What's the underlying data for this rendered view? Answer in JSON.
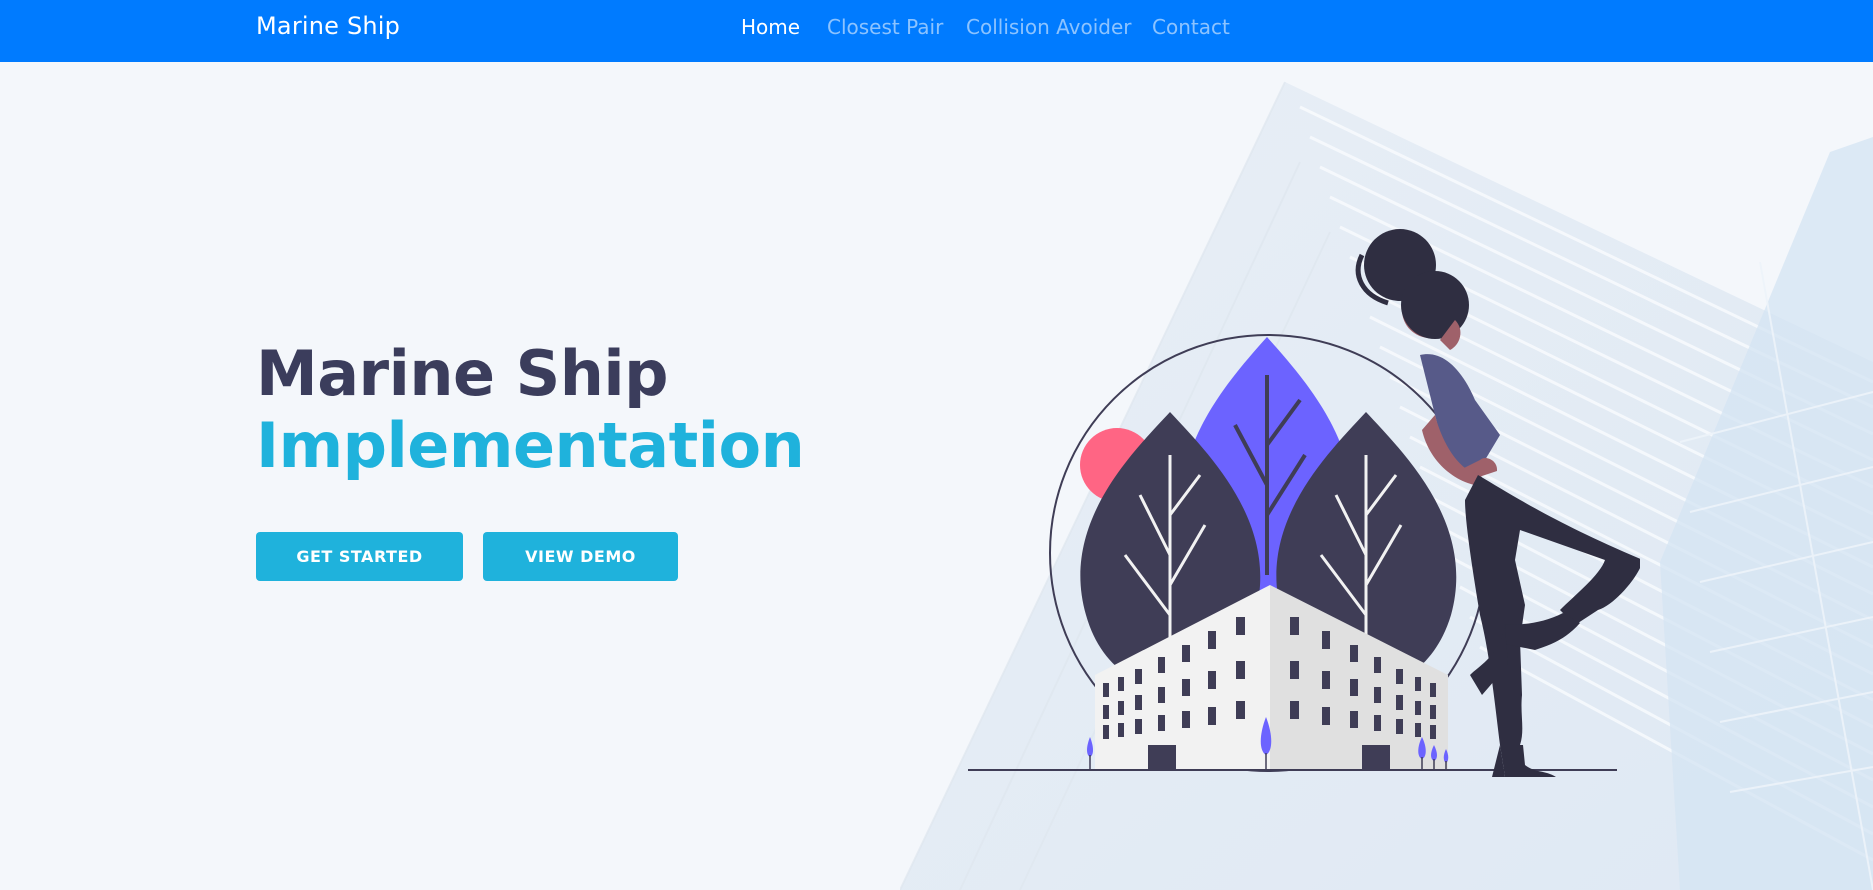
{
  "navbar": {
    "brand": "Marine Ship",
    "links": [
      {
        "label": "Home",
        "active": true
      },
      {
        "label": "Closest Pair",
        "active": false
      },
      {
        "label": "Collision Avoider",
        "active": false
      },
      {
        "label": "Contact",
        "active": false
      }
    ],
    "color": "#007bff"
  },
  "hero": {
    "title_line1": "Marine Ship",
    "title_line2": "Implementation",
    "buttons": {
      "get_started": "GET STARTED",
      "view_demo": "VIEW DEMO"
    }
  },
  "colors": {
    "accent": "#1fb2dc",
    "title_dark": "#3b3d5c",
    "background": "#f4f7fb",
    "illustration_purple": "#6c63ff",
    "illustration_dark": "#3f3d56",
    "illustration_pink": "#ff6584"
  },
  "illustration": {
    "icon": "woman-leaning-on-building-illustration"
  }
}
